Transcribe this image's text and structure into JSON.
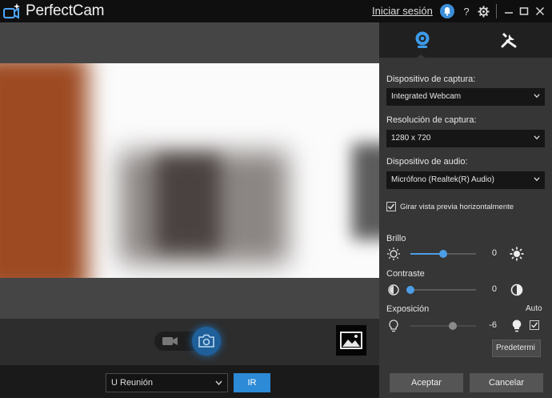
{
  "app": {
    "title": "PerfectCam",
    "signin_label": "Iniciar sesión",
    "help_label": "?",
    "accent_color": "#2c8ad6"
  },
  "titlebar": {
    "icons": [
      "bell-icon",
      "help-icon",
      "gear-icon",
      "minimize-icon",
      "maximize-icon",
      "close-icon"
    ]
  },
  "bottom_bar": {
    "meeting_select_value": "U Reunión",
    "go_label": "IR"
  },
  "panel": {
    "tabs": [
      "camera-settings-tab",
      "tools-tab"
    ],
    "capture_device": {
      "label": "Dispositivo de captura:",
      "value": "Integrated Webcam"
    },
    "capture_resolution": {
      "label": "Resolución de captura:",
      "value": "1280 x 720"
    },
    "audio_device": {
      "label": "Dispositivo de audio:",
      "value": "Micrófono (Realtek(R) Audio)"
    },
    "flip_preview": {
      "label": "Girar vista previa horizontalmente",
      "checked": true
    },
    "brightness": {
      "label": "Brillo",
      "value": "0",
      "level": 0.5
    },
    "contrast": {
      "label": "Contraste",
      "value": "0",
      "level": 0.0
    },
    "exposure": {
      "label": "Exposición",
      "value": "-6",
      "level": 0.65,
      "auto_label": "Auto",
      "auto_checked": true
    },
    "default_label": "Predetermi",
    "accept_label": "Aceptar",
    "cancel_label": "Cancelar"
  }
}
